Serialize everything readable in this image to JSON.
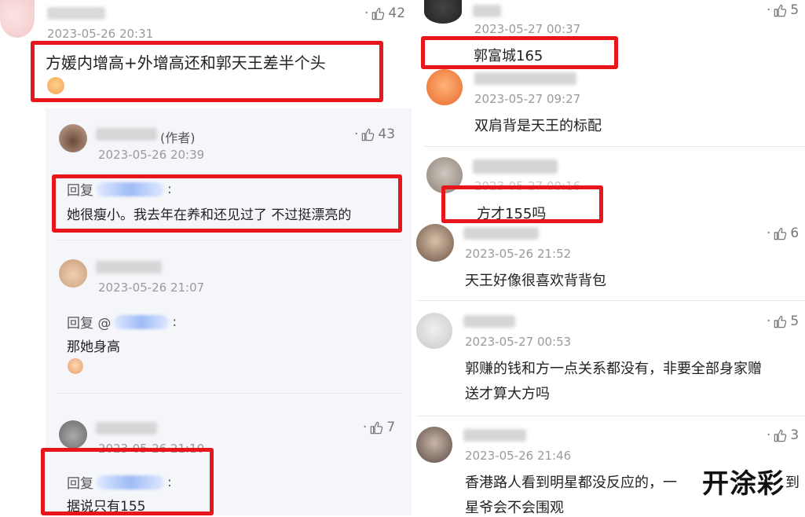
{
  "left": {
    "main_comment": {
      "time": "2023-05-26 20:31",
      "likes": "42",
      "text": "方媛内增高+外增高还和郭天王差半个头"
    },
    "replies": [
      {
        "author_tag": "(作者)",
        "time": "2023-05-26 20:39",
        "likes": "43",
        "reply_label": "回复",
        "colon": ":",
        "text": "她很瘦小。我去年在养和还见过了 不过挺漂亮的"
      },
      {
        "time": "2023-05-26 21:07",
        "reply_label": "回复 @",
        "colon": ":",
        "text": "那她身高"
      },
      {
        "time": "2023-05-26 21:10",
        "likes": "7",
        "reply_label": "回复",
        "colon": ":",
        "text": "据说只有155"
      }
    ]
  },
  "right": {
    "comments": [
      {
        "time": "2023-05-27 00:37",
        "likes": "5",
        "text": "郭富城165"
      },
      {
        "time": "2023-05-27 09:27",
        "text": "双肩背是天王的标配"
      },
      {
        "time": "2023-05-27 00:16",
        "text": "方才155吗"
      },
      {
        "time": "2023-05-26 21:52",
        "likes": "6",
        "text": "天王好像很喜欢背背包"
      },
      {
        "time": "2023-05-27 00:53",
        "likes": "5",
        "text_line1": "郭赚的钱和方一点关系都没有，非要全部身家赠",
        "text_line2": "送才算大方吗"
      },
      {
        "time": "2023-05-26 21:46",
        "likes": "3",
        "text_line1": "香港路人看到明星都没反应的，一",
        "text_line1_tail": "到",
        "text_line2": "星爷会不会围观"
      }
    ]
  },
  "watermark": "开涂彩",
  "colors": {
    "highlight_box": "#e8161b",
    "reply_panel": "#f4f6fa",
    "mention_blur": "#9fbbf6"
  }
}
